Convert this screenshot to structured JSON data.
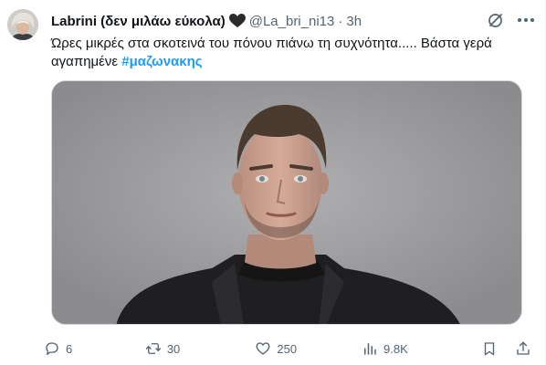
{
  "author": {
    "name": "Labrini (δεν μιλάω εύκολα)",
    "handle": "@La_bri_ni13",
    "separator": "·",
    "time": "3h"
  },
  "post": {
    "text": "Ώρες μικρές στα σκοτεινά του πόνου πιάνω τη συχνότητα..... Βάστα γερά αγαπημένε",
    "hashtag": "#μαζωνακης"
  },
  "actions": {
    "replies": "6",
    "reposts": "30",
    "likes": "250",
    "views": "9.8K"
  },
  "icons": {
    "heart": "black-heart-icon",
    "grok": "grok-icon",
    "more": "more-icon",
    "reply": "reply-icon",
    "repost": "repost-icon",
    "like": "like-icon",
    "views": "views-icon",
    "bookmark": "bookmark-icon",
    "share": "share-icon"
  },
  "colors": {
    "text": "#0f1419",
    "secondary": "#536471",
    "link": "#1d9bf0"
  }
}
